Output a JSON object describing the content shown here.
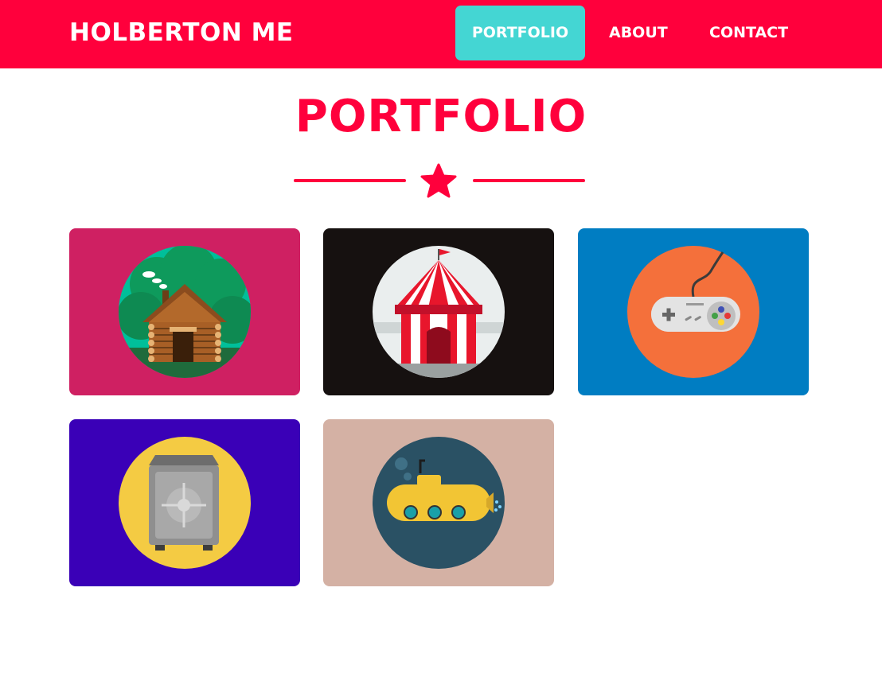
{
  "navbar": {
    "brand": "HOLBERTON ME",
    "links": [
      {
        "label": "PORTFOLIO",
        "active": true
      },
      {
        "label": "ABOUT",
        "active": false
      },
      {
        "label": "CONTACT",
        "active": false
      }
    ],
    "background": "#ff003c",
    "active_color": "#44d6d3"
  },
  "main": {
    "title": "PORTFOLIO",
    "divider_icon": "star-icon",
    "accent": "#ff003c"
  },
  "portfolio": {
    "items": [
      {
        "icon": "log-cabin-icon",
        "background": "#cf2062",
        "circle": "#00bf9a"
      },
      {
        "icon": "circus-tent-icon",
        "background": "#161110",
        "circle": "#eaeeee"
      },
      {
        "icon": "game-controller-icon",
        "background": "#007dc2",
        "circle": "#f4703b"
      },
      {
        "icon": "safe-icon",
        "background": "#3a00b7",
        "circle": "#f4cb43"
      },
      {
        "icon": "submarine-icon",
        "background": "#d4b1a4",
        "circle": "#2a5164"
      }
    ]
  }
}
